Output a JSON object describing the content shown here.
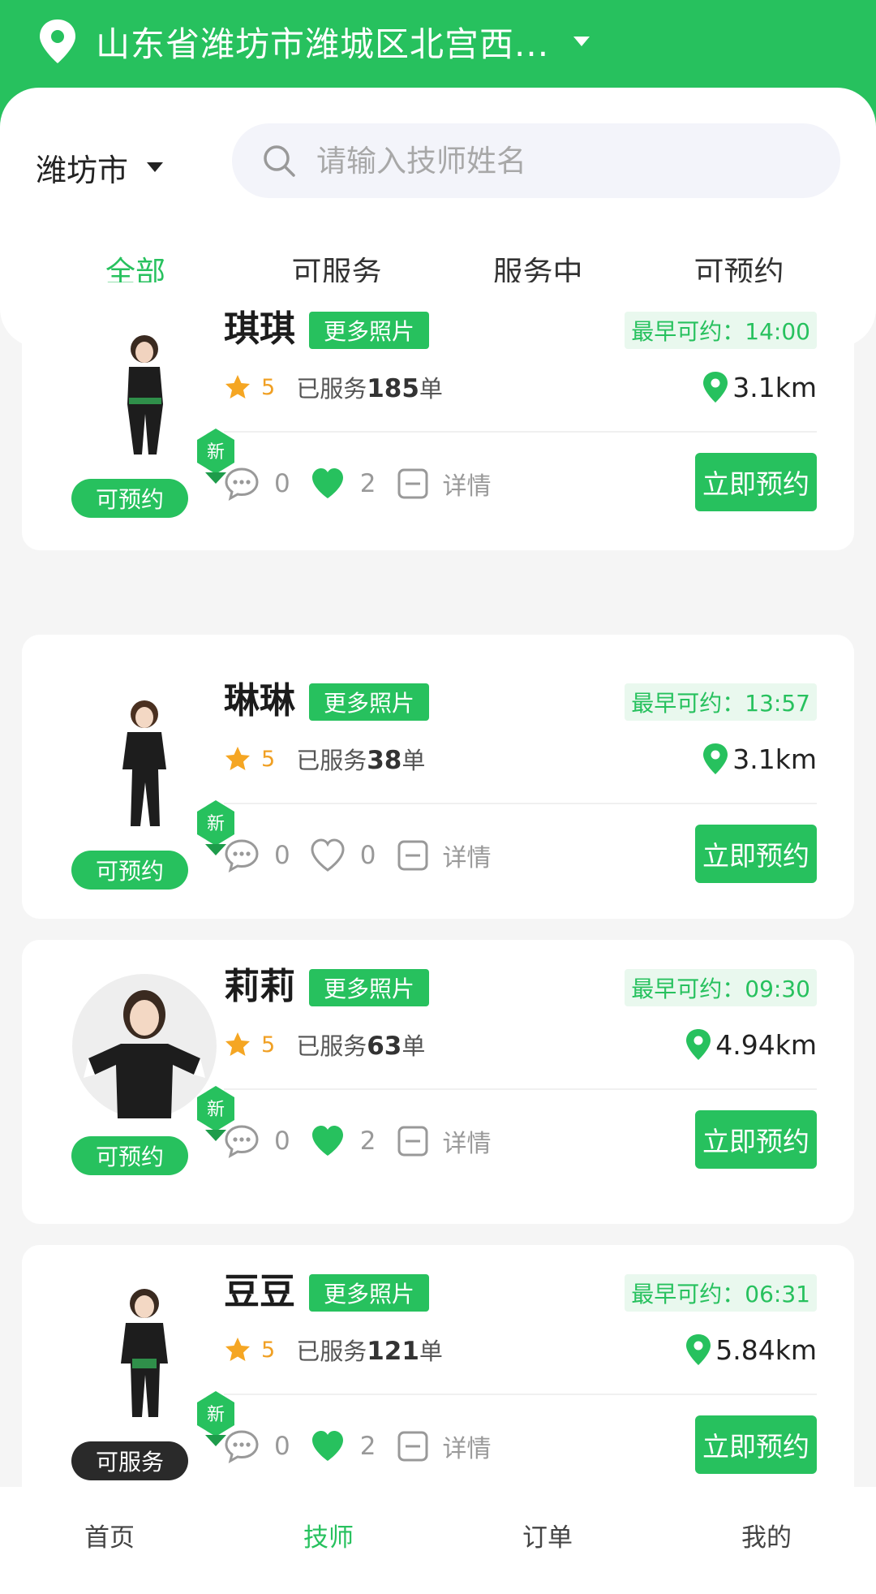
{
  "header": {
    "location": "山东省潍坊市潍城区北宫西...",
    "city": "潍坊市",
    "search_placeholder": "请输入技师姓名"
  },
  "tabs": [
    {
      "label": "全部",
      "active": true
    },
    {
      "label": "可服务",
      "active": false
    },
    {
      "label": "服务中",
      "active": false
    },
    {
      "label": "可预约",
      "active": false
    }
  ],
  "labels": {
    "more_photos": "更多照片",
    "details": "详情",
    "book_now": "立即预约",
    "new_badge": "新",
    "served_prefix": "已服务",
    "served_suffix": "单"
  },
  "technicians": [
    {
      "name": "琪琪",
      "earliest": "最早可约：14:00",
      "rating": "5",
      "served": "185",
      "distance": "3.1km",
      "comments": "0",
      "likes": "2",
      "liked": true,
      "status": "可预约",
      "status_dark": false
    },
    {
      "name": "琳琳",
      "earliest": "最早可约：13:57",
      "rating": "5",
      "served": "38",
      "distance": "3.1km",
      "comments": "0",
      "likes": "0",
      "liked": false,
      "status": "可预约",
      "status_dark": false
    },
    {
      "name": "莉莉",
      "earliest": "最早可约：09:30",
      "rating": "5",
      "served": "63",
      "distance": "4.94km",
      "comments": "0",
      "likes": "2",
      "liked": true,
      "status": "可预约",
      "status_dark": false
    },
    {
      "name": "豆豆",
      "earliest": "最早可约：06:31",
      "rating": "5",
      "served": "121",
      "distance": "5.84km",
      "comments": "0",
      "likes": "2",
      "liked": true,
      "status": "可服务",
      "status_dark": true
    }
  ],
  "bottom_nav": [
    {
      "label": "首页",
      "active": false
    },
    {
      "label": "技师",
      "active": true
    },
    {
      "label": "订单",
      "active": false
    },
    {
      "label": "我的",
      "active": false
    }
  ],
  "colors": {
    "brand": "#27c15e",
    "rating": "#f0a024",
    "dark_pill": "#2a2a2a"
  }
}
